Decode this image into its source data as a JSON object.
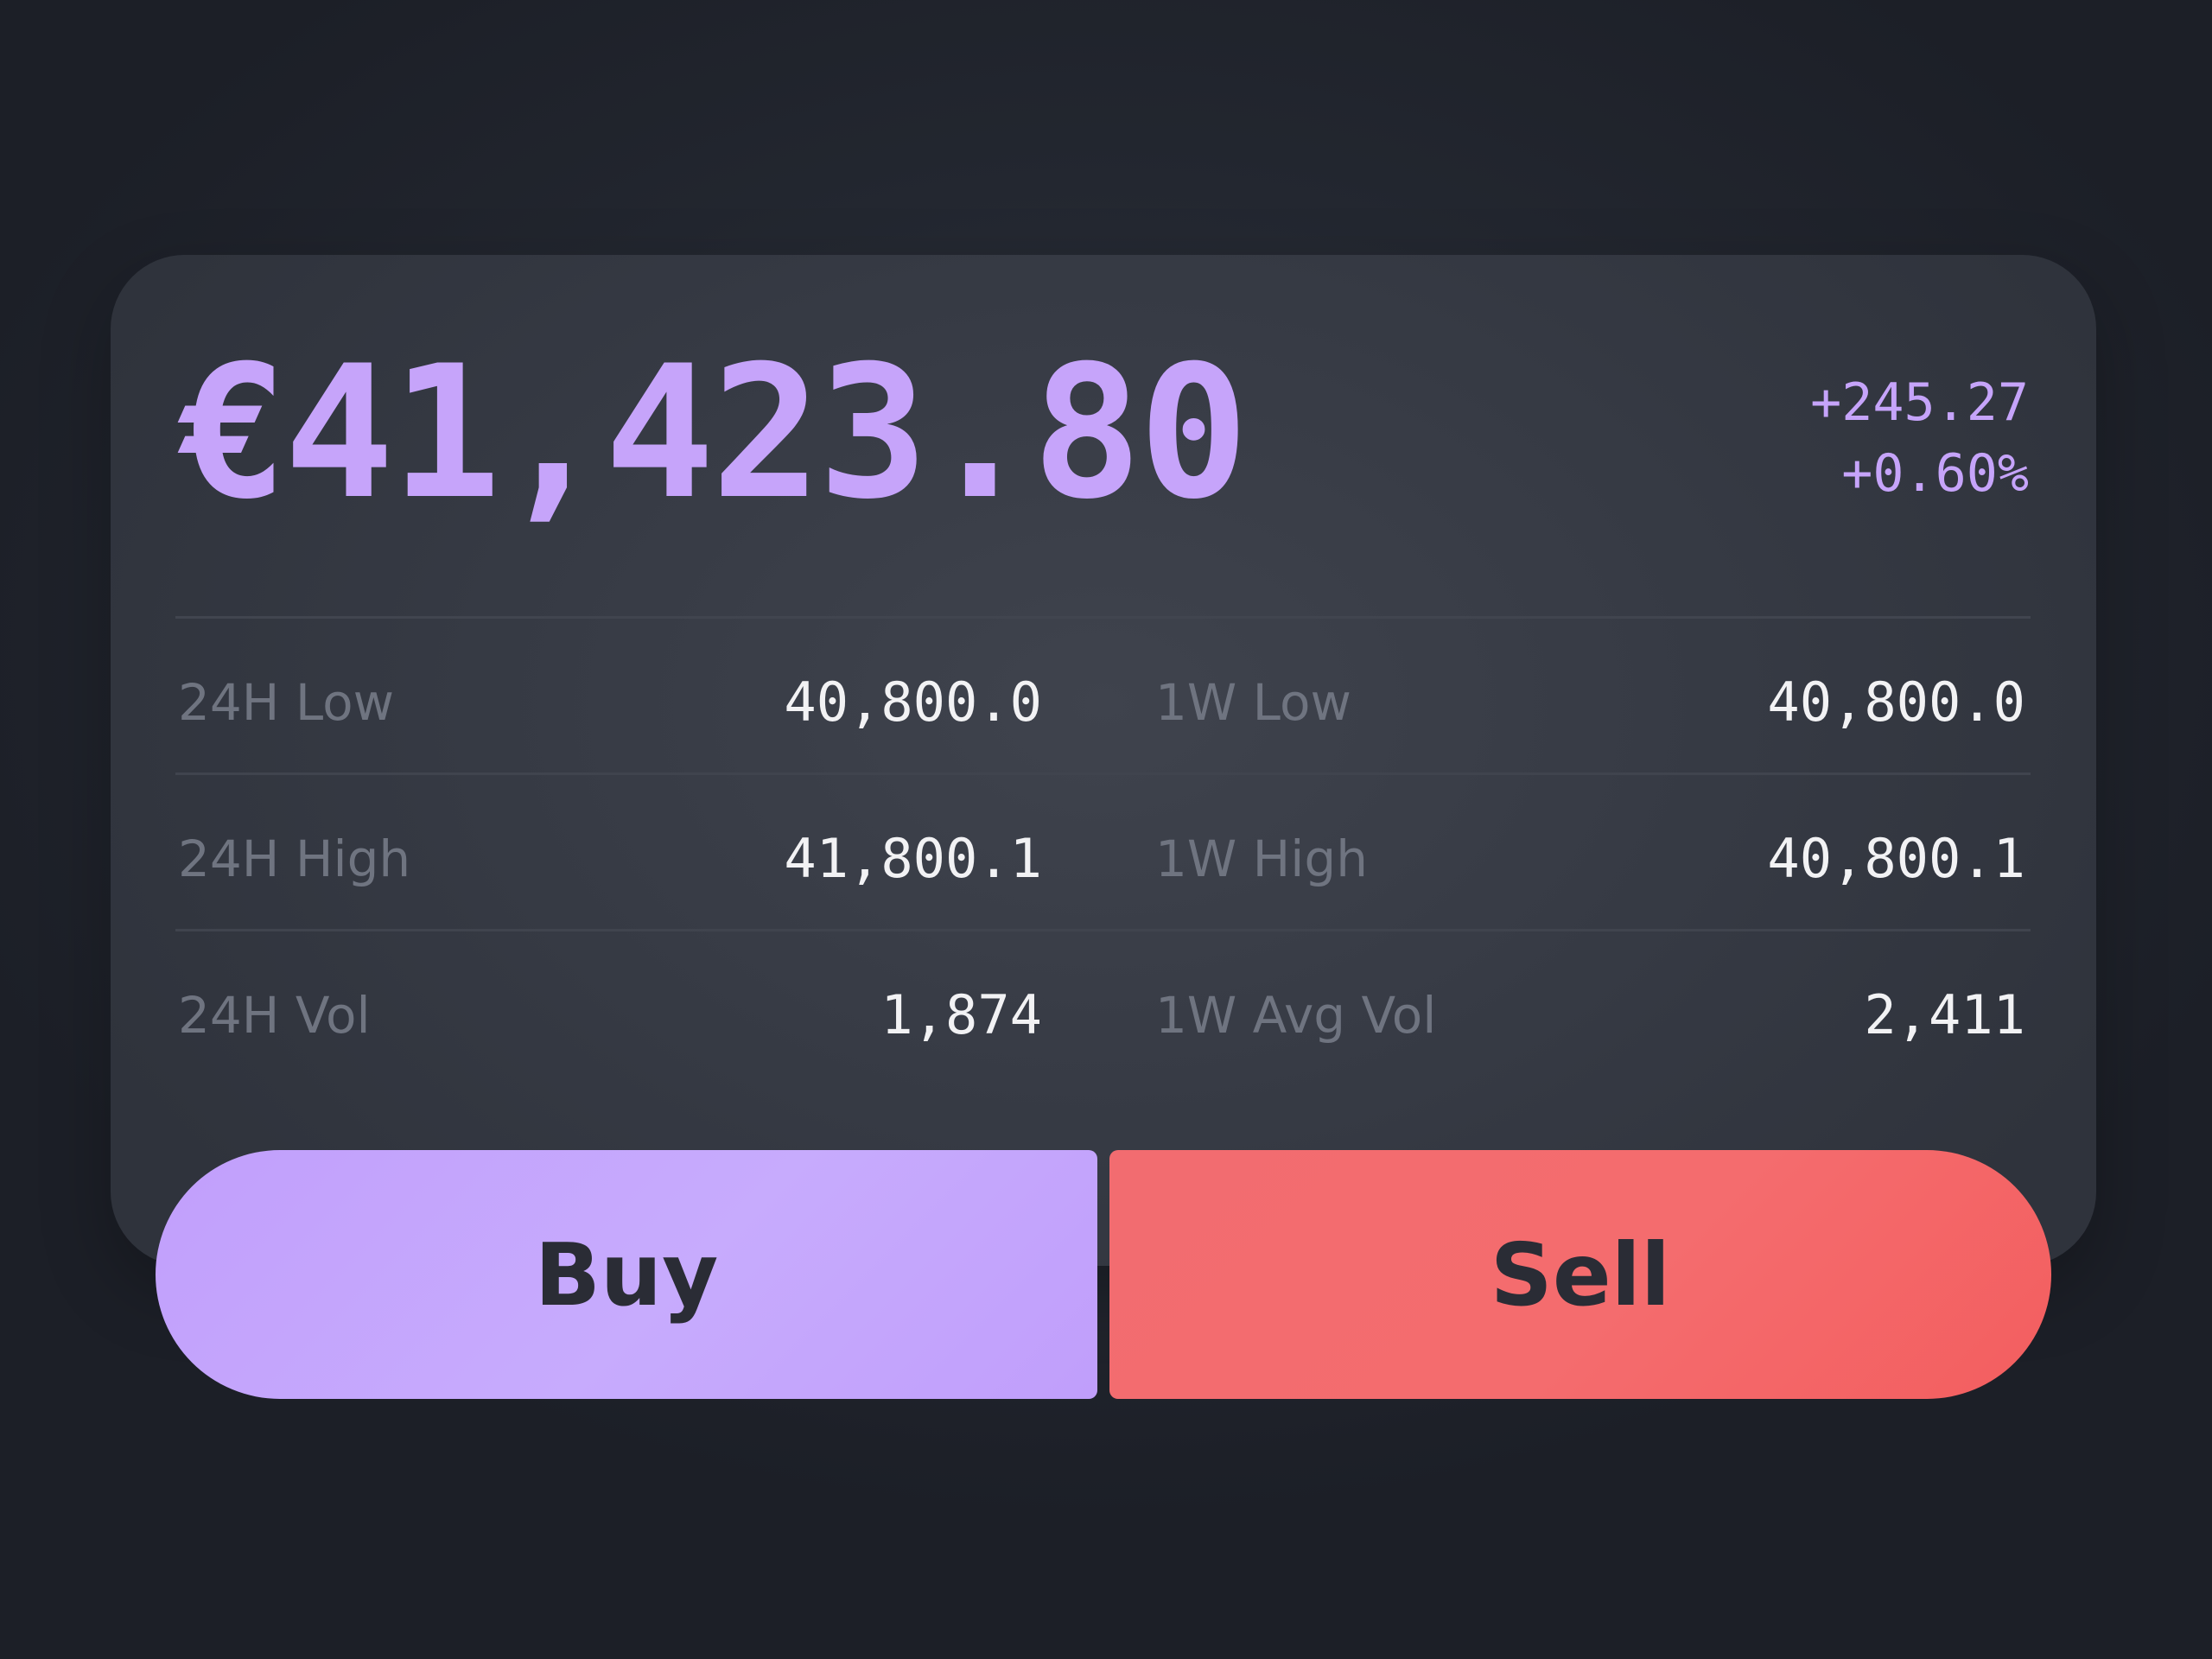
{
  "ticker": {
    "price": "€41,423.80",
    "change_abs": "+245.27",
    "change_pct": "+0.60%"
  },
  "stats": [
    {
      "left_label": "24H Low",
      "left_value": "40,800.0",
      "right_label": "1W Low",
      "right_value": "40,800.0"
    },
    {
      "left_label": "24H High",
      "left_value": "41,800.1",
      "right_label": "1W High",
      "right_value": "40,800.1"
    },
    {
      "left_label": "24H Vol",
      "left_value": "1,874",
      "right_label": "1W Avg Vol",
      "right_value": "2,411"
    }
  ],
  "actions": {
    "buy_label": "Buy",
    "sell_label": "Sell"
  },
  "colors": {
    "accent": "#c6a4fa",
    "sell": "#f46c6e",
    "value_text": "#f2f2f4",
    "label_text": "#6f7480"
  }
}
